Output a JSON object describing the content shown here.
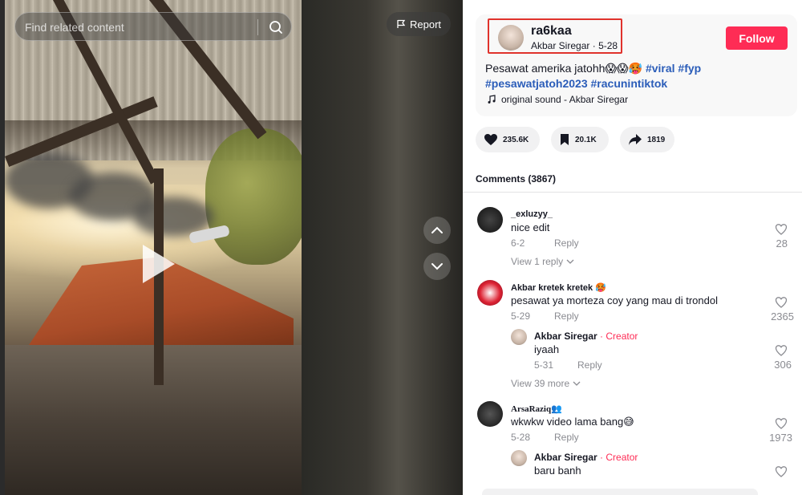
{
  "search": {
    "placeholder": "Find related content"
  },
  "video": {
    "report_label": "Report"
  },
  "author": {
    "username": "ra6kaa",
    "display_name": "Akbar Siregar",
    "date": "5-28",
    "follow_label": "Follow"
  },
  "caption": {
    "text": "Pesawat amerika jatohh😱😱🥵 ",
    "hashtags": [
      "#viral",
      "#fyp",
      "#pesawatjatoh2023",
      "#racunintiktok"
    ]
  },
  "music": {
    "label": "original sound - Akbar Siregar"
  },
  "actions": {
    "likes": "235.6K",
    "saves": "20.1K",
    "shares": "1819"
  },
  "comments_header": "Comments (3867)",
  "comments": [
    {
      "name": "_exluzyy_",
      "text": "nice edit",
      "date": "6-2",
      "reply": "Reply",
      "likes": "28",
      "more": "View 1 reply"
    },
    {
      "name": "Akbar kretek kretek 🥵",
      "text": "pesawat ya morteza coy yang mau di trondol",
      "date": "5-29",
      "reply": "Reply",
      "likes": "2365",
      "sub": {
        "name": "Akbar Siregar",
        "creator": " · Creator",
        "text": "iyaah",
        "date": "5-31",
        "reply": "Reply",
        "likes": "306"
      },
      "more": "View 39 more"
    },
    {
      "name": "ArsaRaziq👥",
      "text": "wkwkw video lama bang😅",
      "date": "5-28",
      "reply": "Reply",
      "likes": "1973",
      "sub": {
        "name": "Akbar Siregar",
        "creator": " · Creator",
        "text": "baru banh"
      }
    }
  ],
  "colors": {
    "accent": "#fe2c55",
    "hashtag": "#2b5db9",
    "highlight_border": "#e0322c"
  },
  "icons": [
    "search-icon",
    "flag-icon",
    "play-icon",
    "chevron-up-icon",
    "chevron-down-icon",
    "heart-icon",
    "bookmark-icon",
    "share-icon",
    "music-note-icon"
  ]
}
